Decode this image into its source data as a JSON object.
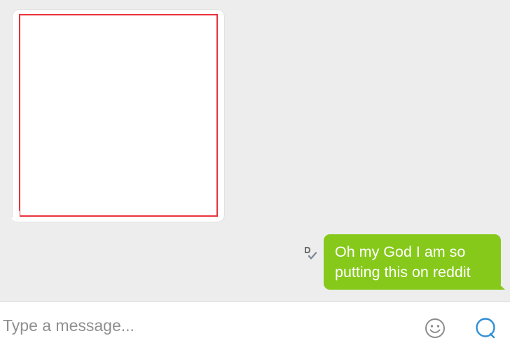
{
  "conversation": {
    "outgoing_message": "Oh my God I am so\nputting this on reddit"
  },
  "composer": {
    "placeholder": "Type a message..."
  },
  "colors": {
    "outgoing_bubble": "#86c91b",
    "image_border": "#e8333b",
    "send_icon": "#2f8fd6",
    "emoji_icon": "#8c8c8c"
  },
  "icons": {
    "read_receipt": "read-receipt-icon",
    "emoji": "smiley-icon",
    "send": "send-bubble-icon"
  }
}
